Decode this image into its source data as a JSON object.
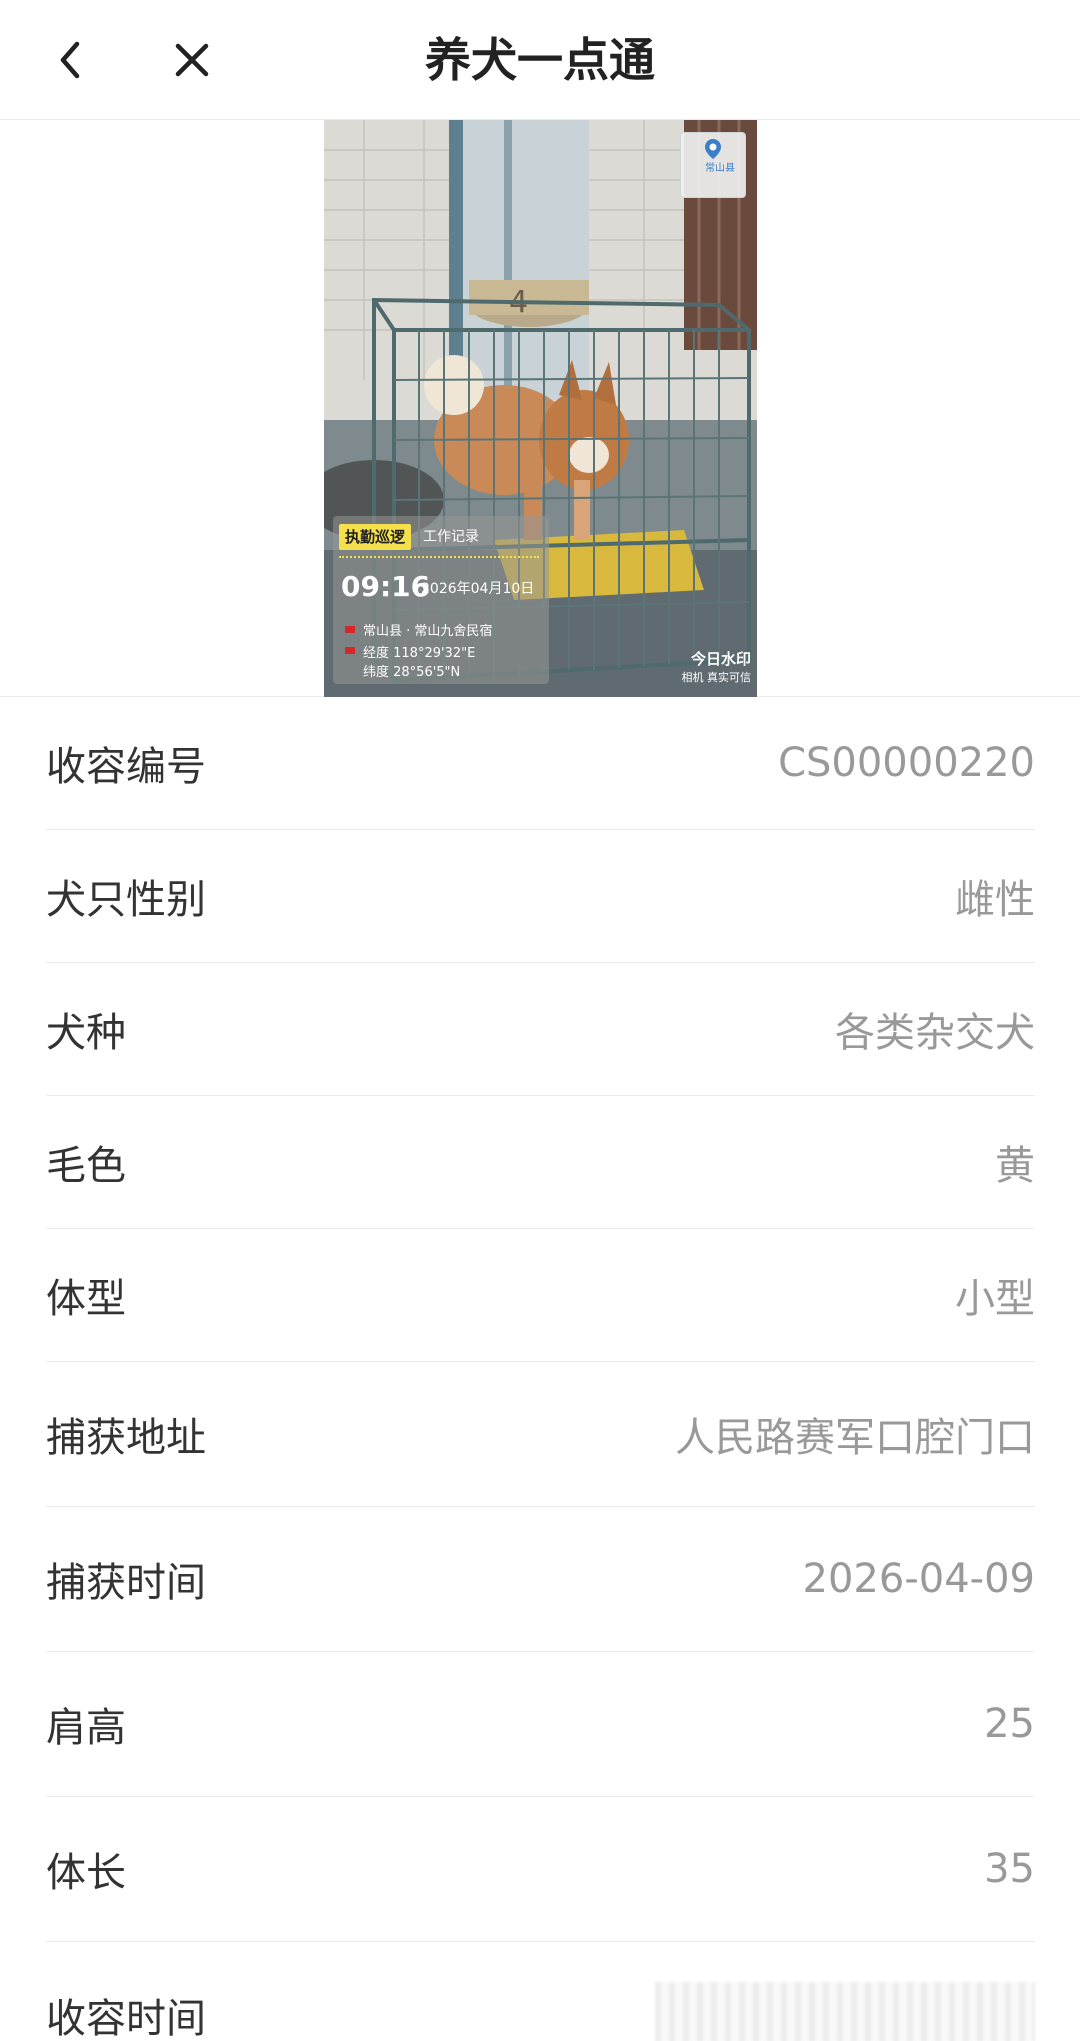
{
  "nav": {
    "title": "养犬一点通",
    "back_icon": "chevron-left-icon",
    "close_icon": "close-icon"
  },
  "photo": {
    "description_icon": "dog-in-cage-photo",
    "watermark": {
      "tag": "执勤巡逻",
      "label": "工作记录",
      "time": "09:16",
      "date": "2026年04月10日",
      "location": "常山县 · 常山九舍民宿",
      "longitude": "经度 118°29'32\"E",
      "latitude": "纬度 28°56'5\"N"
    },
    "map_badge": {
      "name": "常山县"
    },
    "brand": {
      "name": "今日水印",
      "sub": "相机 真实可信"
    }
  },
  "fields": [
    {
      "label": "收容编号",
      "value": "CS00000220"
    },
    {
      "label": "犬只性别",
      "value": "雌性"
    },
    {
      "label": "犬种",
      "value": "各类杂交犬"
    },
    {
      "label": "毛色",
      "value": "黄"
    },
    {
      "label": "体型",
      "value": "小型"
    },
    {
      "label": "捕获地址",
      "value": "人民路赛军口腔门口"
    },
    {
      "label": "捕获时间",
      "value": "2026-04-09"
    },
    {
      "label": "肩高",
      "value": "25"
    },
    {
      "label": "体长",
      "value": "35"
    },
    {
      "label": "收容时间",
      "value": ""
    }
  ],
  "colors": {
    "label": "#333333",
    "value": "#999999",
    "divider": "#ececec",
    "watermark_accent": "#f4e04c"
  }
}
